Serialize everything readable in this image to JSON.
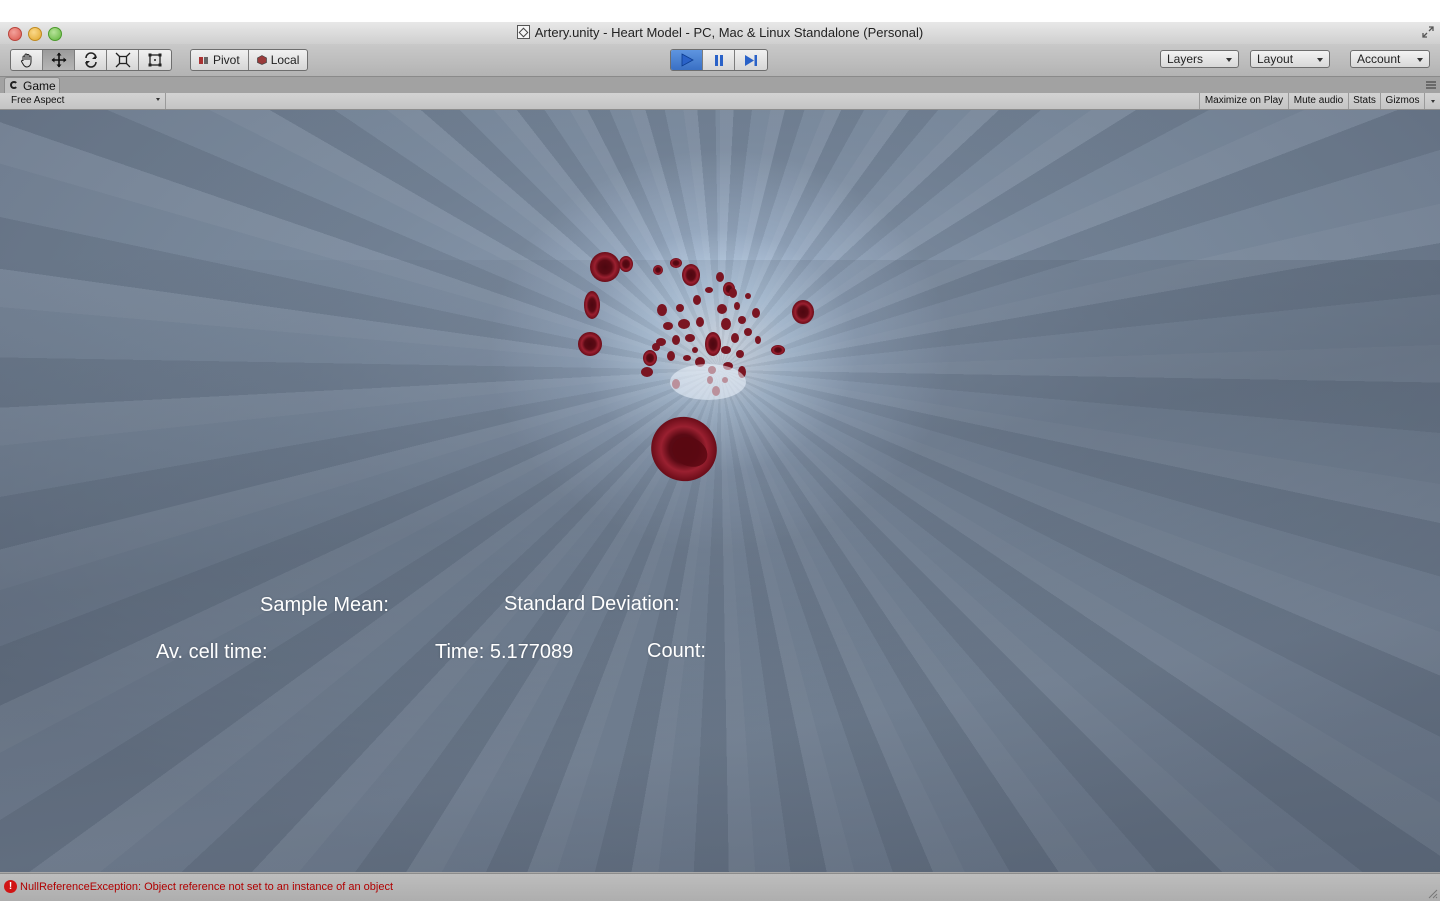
{
  "window": {
    "title": "Artery.unity - Heart Model - PC, Mac & Linux Standalone (Personal)"
  },
  "toolbar": {
    "tools": [
      "hand-icon",
      "move-icon",
      "rotate-icon",
      "scale-icon",
      "rect-tool-icon"
    ],
    "pivot_label": "Pivot",
    "local_label": "Local",
    "layers_label": "Layers",
    "layout_label": "Layout",
    "account_label": "Account",
    "play_state": "playing"
  },
  "game_view": {
    "tab_label": "Game",
    "aspect_label": "Free Aspect",
    "maximize_label": "Maximize on Play",
    "mute_label": "Mute audio",
    "stats_label": "Stats",
    "gizmos_label": "Gizmos"
  },
  "hud": {
    "sample_mean_label": "Sample Mean:",
    "std_dev_label": "Standard Deviation:",
    "av_cell_time_label": "Av. cell time:",
    "time_label": "Time: 5.177089",
    "count_label": "Count:"
  },
  "status": {
    "error_message": "NullReferenceException: Object reference not set to an instance of an object"
  },
  "colors": {
    "cell_red": "#7a0f1c",
    "play_blue": "#3a70c4",
    "error_red": "#b00000"
  }
}
